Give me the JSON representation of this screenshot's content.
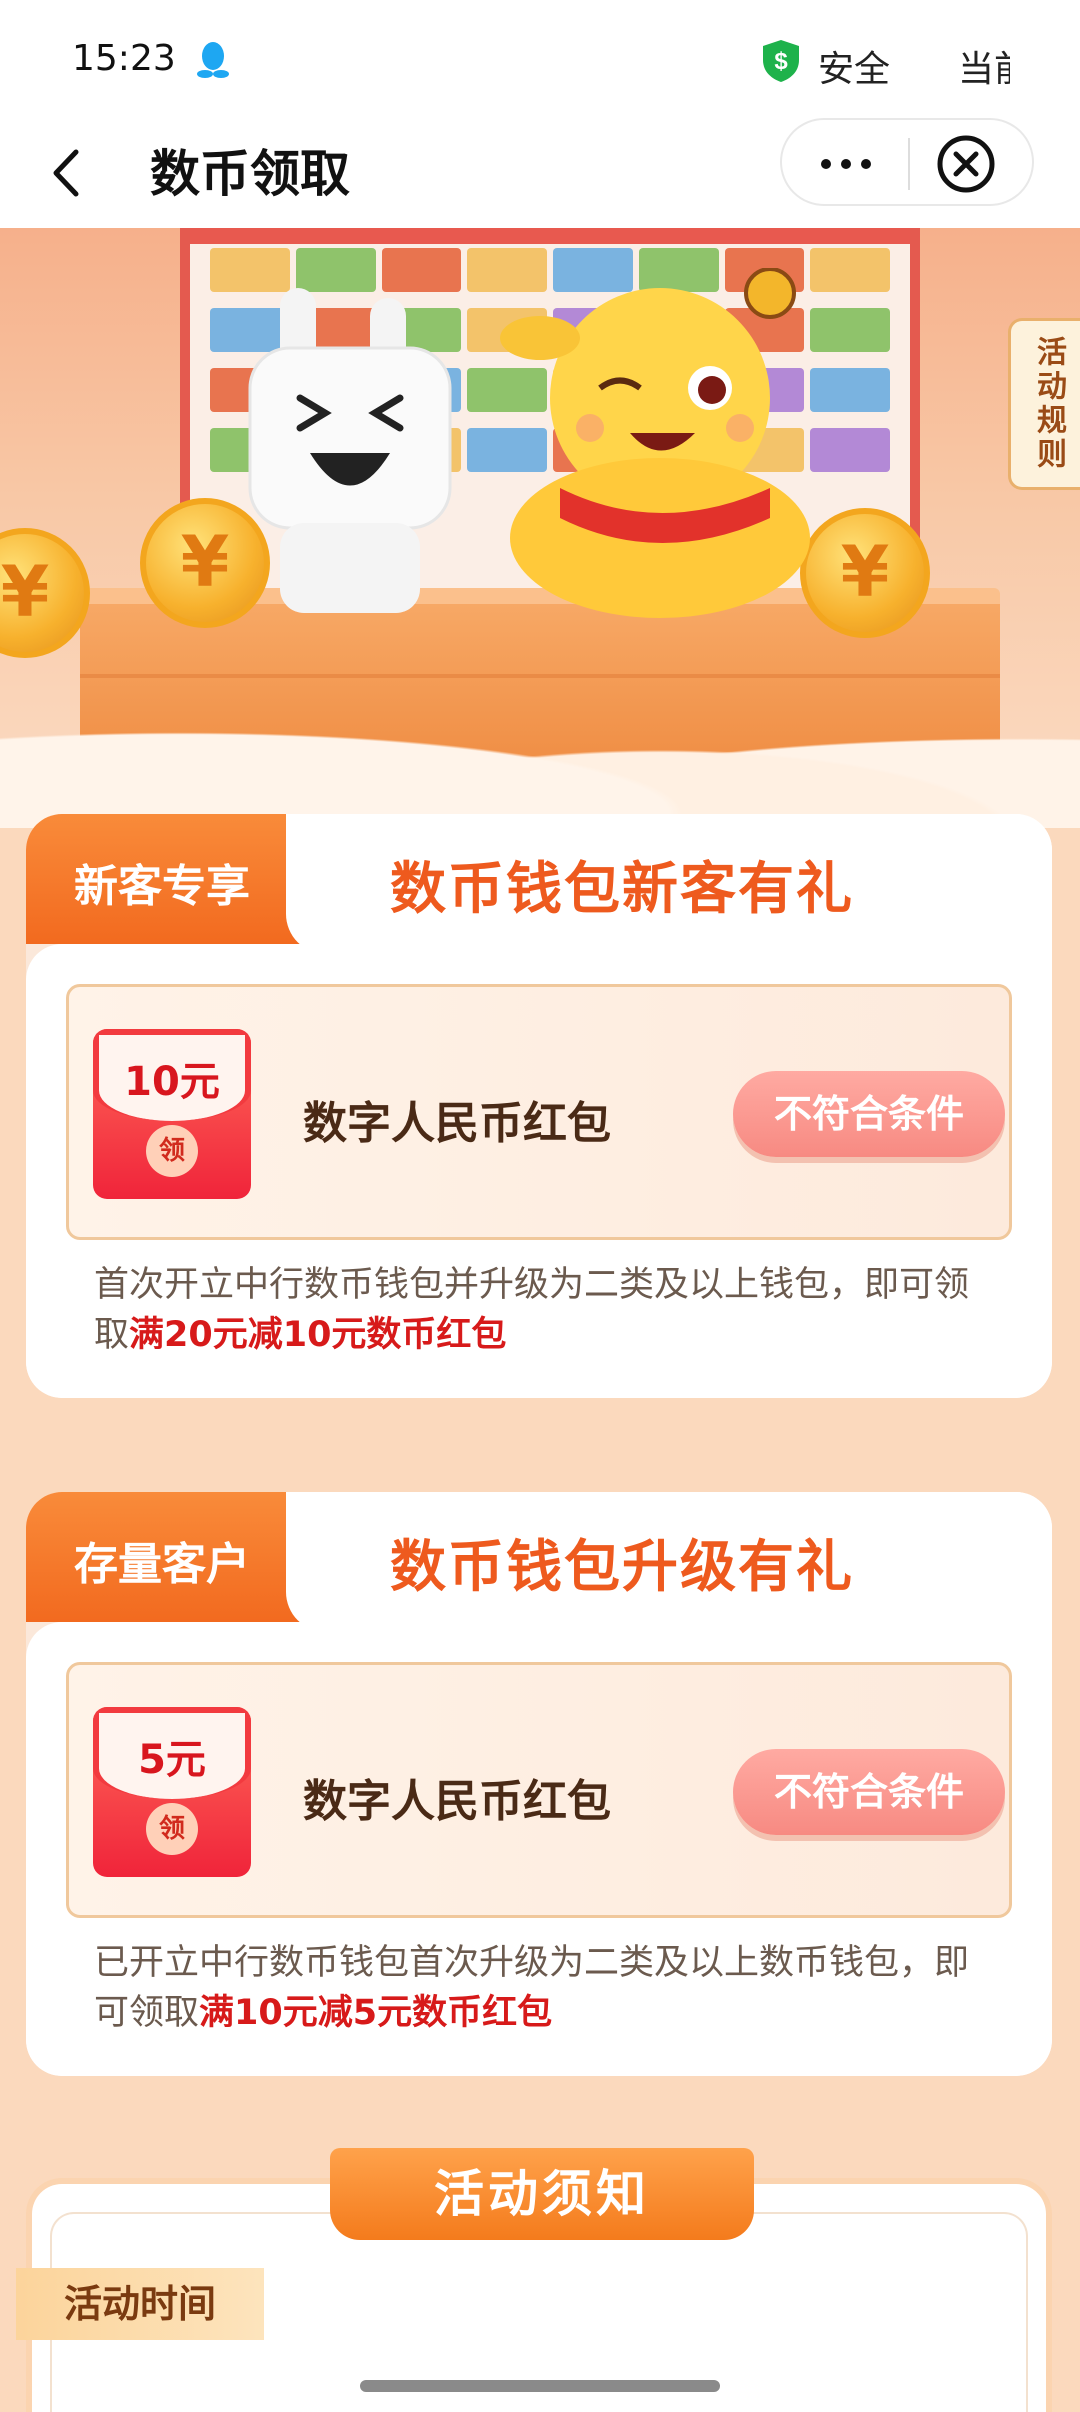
{
  "status_bar": {
    "time": "15:23",
    "safety_label": "安全",
    "cut_text": "当前"
  },
  "nav": {
    "title": "数币领取"
  },
  "banner": {
    "rules_tab": "活动规则",
    "coin_symbol": "¥"
  },
  "cards": [
    {
      "tag": "新客专享",
      "title": "数币钱包新客有礼",
      "coupon": {
        "amount": "10元",
        "seal": "领",
        "name": "数字人民币红包",
        "button": "不符合条件"
      },
      "desc_prefix": "首次开立中行数币钱包并升级为二类及以上钱包，即可领取",
      "desc_highlight": "满20元减10元数币红包"
    },
    {
      "tag": "存量客户",
      "title": "数币钱包升级有礼",
      "coupon": {
        "amount": "5元",
        "seal": "领",
        "name": "数字人民币红包",
        "button": "不符合条件"
      },
      "desc_prefix": "已开立中行数币钱包首次升级为二类及以上数币钱包，即可领取",
      "desc_highlight": "满10元减5元数币红包"
    }
  ],
  "notice": {
    "title": "活动须知",
    "section": "活动时间"
  },
  "colors": {
    "accent_orange": "#f26a1f",
    "title_orange": "#ee5a1e",
    "highlight_red": "#d71a1a",
    "page_bg": "#fbd9bd"
  }
}
